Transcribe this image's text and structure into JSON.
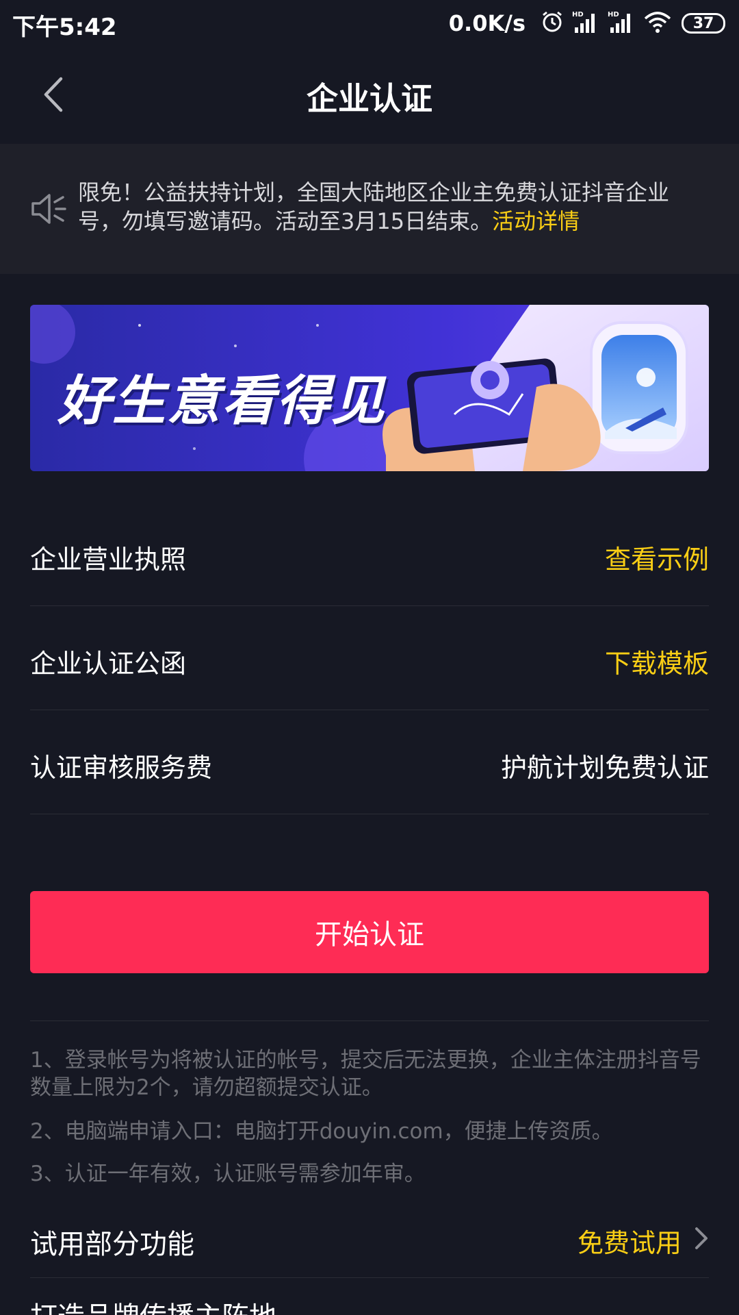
{
  "status_bar": {
    "time": "下午5:42",
    "net_speed": "0.0K/s",
    "battery_level": "37",
    "icons": [
      "alarm-icon",
      "signal-hd-icon",
      "signal-hd-icon",
      "wifi-icon",
      "battery-icon"
    ]
  },
  "header": {
    "title": "企业认证",
    "back_icon": "chevron-left-icon"
  },
  "notice": {
    "icon": "speaker-icon",
    "text": "限免！公益扶持计划，全国大陆地区企业主免费认证抖音企业号，勿填写邀请码。活动至3月15日结束。",
    "link": "活动详情"
  },
  "banner": {
    "headline": "好生意看得见"
  },
  "rows": [
    {
      "label": "企业营业执照",
      "value": "查看示例"
    },
    {
      "label": "企业认证公函",
      "value": "下载模板"
    },
    {
      "label": "认证审核服务费",
      "value": "护航计划免费认证"
    }
  ],
  "primary_button": {
    "label": "开始认证"
  },
  "notes": [
    "1、登录帐号为将被认证的帐号，提交后无法更换，企业主体注册抖音号数量上限为2个，请勿超额提交认证。",
    "2、电脑端申请入口：电脑打开douyin.com，便捷上传资质。",
    "3、认证一年有效，认证账号需参加年审。"
  ],
  "trial": {
    "label": "试用部分功能",
    "link": "免费试用"
  },
  "next_row": {
    "label": "打造品牌传播主阵地"
  },
  "colors": {
    "background": "#161823",
    "notice_bg": "#1f2029",
    "accent_yellow": "#face15",
    "primary_red": "#fe2c55",
    "note_gray": "#6e6f76"
  }
}
